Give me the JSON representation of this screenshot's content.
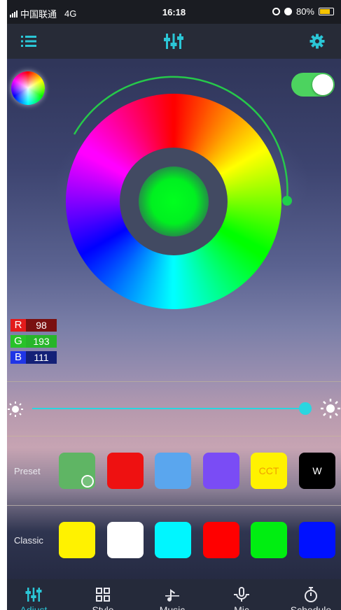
{
  "status_bar": {
    "carrier": "中国联通",
    "network": "4G",
    "time": "16:18",
    "battery": "80%",
    "battery_level": 0.8
  },
  "toolbar": {
    "menu_icon": "list-icon",
    "center_icon": "equalizer-sliders-icon",
    "settings_icon": "gear-icon",
    "accent": "#2bc6d6"
  },
  "color": {
    "r_label": "R",
    "r_value": "98",
    "g_label": "G",
    "g_value": "193",
    "b_label": "B",
    "b_value": "111",
    "preview_color": "#00ff1e",
    "power_on": true
  },
  "brightness": {
    "level": 0.98,
    "min_icon": "sun-small-icon",
    "max_icon": "sun-large-icon"
  },
  "preset": {
    "label": "Preset",
    "swatches": [
      {
        "color": "#5fb564",
        "text": "",
        "selected": true
      },
      {
        "color": "#ee1111",
        "text": ""
      },
      {
        "color": "#5aa6ee",
        "text": ""
      },
      {
        "color": "#7a4cf5",
        "text": ""
      },
      {
        "color": "#fff200",
        "text": "CCT",
        "text_color": "#f0a000"
      },
      {
        "color": "#000000",
        "text": "W",
        "text_color": "#ffffff"
      }
    ]
  },
  "classic": {
    "label": "Classic",
    "swatches": [
      {
        "color": "#fff200"
      },
      {
        "color": "#ffffff"
      },
      {
        "color": "#00f6ff"
      },
      {
        "color": "#ff0000"
      },
      {
        "color": "#00ee11"
      },
      {
        "color": "#0011ff"
      }
    ]
  },
  "nav": {
    "items": [
      {
        "label": "Adjust",
        "icon": "sliders-icon",
        "active": true
      },
      {
        "label": "Style",
        "icon": "grid-icon"
      },
      {
        "label": "Music",
        "icon": "music-note-icon"
      },
      {
        "label": "Mic",
        "icon": "microphone-icon"
      },
      {
        "label": "Schedule",
        "icon": "timer-icon"
      }
    ],
    "active_color": "#2bc6d6"
  }
}
